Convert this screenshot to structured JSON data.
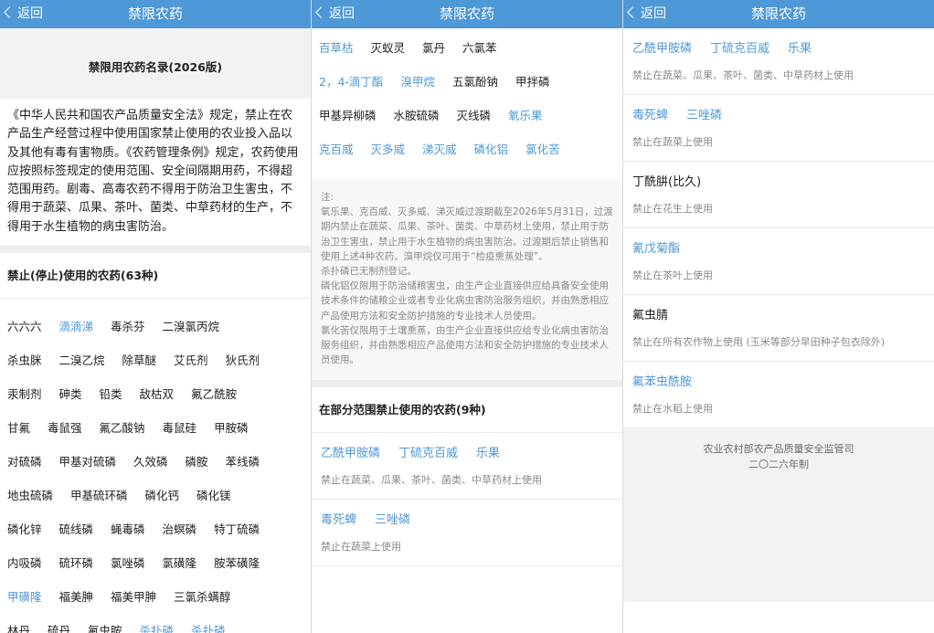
{
  "nav": {
    "back_label": "返回",
    "title": "禁限农药"
  },
  "panel1": {
    "list_title": "禁限用农药名录(2026版)",
    "intro_paragraph": "《中华人民共和国农产品质量安全法》规定，禁止在农产品生产经营过程中使用国家禁止使用的农业投入品以及其他有毒有害物质。《农药管理条例》规定，农药使用应按照标签规定的使用范围、安全间隔期用药，不得超范围用药。剧毒、高毒农药不得用于防治卫生害虫，不得用于蔬菜、瓜果、茶叶、菌类、中草药材的生产，不得用于水生植物的病虫害防治。",
    "banned_section_title": "禁止(停止)使用的农药(63种)",
    "banned_rows": [
      [
        {
          "name": "六六六",
          "blue": false
        },
        {
          "name": "滴滴涕",
          "blue": true
        },
        {
          "name": "毒杀芬",
          "blue": false
        },
        {
          "name": "二溴氯丙烷",
          "blue": false
        }
      ],
      [
        {
          "name": "杀虫脒",
          "blue": false
        },
        {
          "name": "二溴乙烷",
          "blue": false
        },
        {
          "name": "除草醚",
          "blue": false
        },
        {
          "name": "艾氏剂",
          "blue": false
        },
        {
          "name": "狄氏剂",
          "blue": false
        }
      ],
      [
        {
          "name": "汞制剂",
          "blue": false
        },
        {
          "name": "砷类",
          "blue": false
        },
        {
          "name": "铅类",
          "blue": false
        },
        {
          "name": "敌枯双",
          "blue": false
        },
        {
          "name": "氟乙酰胺",
          "blue": false
        }
      ],
      [
        {
          "name": "甘氟",
          "blue": false
        },
        {
          "name": "毒鼠强",
          "blue": false
        },
        {
          "name": "氟乙酸钠",
          "blue": false
        },
        {
          "name": "毒鼠硅",
          "blue": false
        },
        {
          "name": "甲胺磷",
          "blue": false
        }
      ],
      [
        {
          "name": "对硫磷",
          "blue": false
        },
        {
          "name": "甲基对硫磷",
          "blue": false
        },
        {
          "name": "久效磷",
          "blue": false
        },
        {
          "name": "磷胺",
          "blue": false
        },
        {
          "name": "苯线磷",
          "blue": false
        }
      ],
      [
        {
          "name": "地虫硫磷",
          "blue": false
        },
        {
          "name": "甲基硫环磷",
          "blue": false
        },
        {
          "name": "磷化钙",
          "blue": false
        },
        {
          "name": "磷化镁",
          "blue": false
        }
      ],
      [
        {
          "name": "磷化锌",
          "blue": false
        },
        {
          "name": "硫线磷",
          "blue": false
        },
        {
          "name": "蝇毒磷",
          "blue": false
        },
        {
          "name": "治螟磷",
          "blue": false
        },
        {
          "name": "特丁硫磷",
          "blue": false
        }
      ],
      [
        {
          "name": "内吸磷",
          "blue": false
        },
        {
          "name": "硫环磷",
          "blue": false
        },
        {
          "name": "氯唑磷",
          "blue": false
        },
        {
          "name": "氯磺隆",
          "blue": false
        },
        {
          "name": "胺苯磺隆",
          "blue": false
        }
      ],
      [
        {
          "name": "甲磺隆",
          "blue": true
        },
        {
          "name": "福美胂",
          "blue": false
        },
        {
          "name": "福美甲胂",
          "blue": false
        },
        {
          "name": "三氯杀螨醇",
          "blue": false
        }
      ],
      [
        {
          "name": "林丹",
          "blue": false
        },
        {
          "name": "硫丹",
          "blue": false
        },
        {
          "name": "氟虫胺",
          "blue": false
        },
        {
          "name": "杀扑磷",
          "blue": true
        },
        {
          "name": "杀扑磷",
          "blue": true
        }
      ]
    ]
  },
  "panel2": {
    "banned_rows": [
      [
        {
          "name": "百草枯",
          "blue": true
        },
        {
          "name": "灭蚁灵",
          "blue": false
        },
        {
          "name": "氯丹",
          "blue": false
        },
        {
          "name": "六氯苯",
          "blue": false
        }
      ],
      [
        {
          "name": "2，4-滴丁酯",
          "blue": true
        },
        {
          "name": "溴甲烷",
          "blue": true
        },
        {
          "name": "五氯酚钠",
          "blue": false
        },
        {
          "name": "甲拌磷",
          "blue": false
        }
      ],
      [
        {
          "name": "甲基异柳磷",
          "blue": false
        },
        {
          "name": "水胺硫磷",
          "blue": false
        },
        {
          "name": "灭线磷",
          "blue": false
        },
        {
          "name": "氧乐果",
          "blue": true
        }
      ],
      [
        {
          "name": "克百威",
          "blue": true
        },
        {
          "name": "灭多威",
          "blue": true
        },
        {
          "name": "涕灭威",
          "blue": true
        },
        {
          "name": "磷化铝",
          "blue": true
        },
        {
          "name": "氯化苦",
          "blue": true
        }
      ]
    ],
    "notes": [
      "注:",
      "氧乐果、克百威、灭多威、涕灭威过渡期截至2026年5月31日，过渡期内禁止在蔬菜、瓜果、茶叶、菌类、中草药材上使用，禁止用于防治卫生害虫，禁止用于水生植物的病虫害防治。过渡期后禁止销售和使用上述4种农药。溴甲烷仅可用于“检疫熏蒸处理”。",
      "杀扑磷已无制剂登记。",
      "磷化铝仅限用于防治储粮害虫，由生产企业直接供应给具备安全使用技术条件的储粮企业或者专业化病虫害防治服务组织，并由熟悉相应产品使用方法和安全防护措施的专业技术人员使用。",
      "氯化苦仅限用于土壤熏蒸，由生产企业直接供应给专业化病虫害防治服务组织，并由熟悉相应产品使用方法和安全防护措施的专业技术人员使用。"
    ],
    "restricted_section_title": "在部分范围禁止使用的农药(9种)",
    "restricted": [
      {
        "names": [
          {
            "name": "乙酰甲胺磷",
            "blue": true
          },
          {
            "name": "丁硫克百威",
            "blue": true
          },
          {
            "name": "乐果",
            "blue": true
          }
        ],
        "desc": "禁止在蔬菜、瓜果、茶叶、菌类、中草药材上使用"
      },
      {
        "names": [
          {
            "name": "毒死蜱",
            "blue": true
          },
          {
            "name": "三唑磷",
            "blue": true
          }
        ],
        "desc": "禁止在蔬菜上使用"
      }
    ]
  },
  "panel3": {
    "restricted": [
      {
        "names": [
          {
            "name": "乙酰甲胺磷",
            "blue": true
          },
          {
            "name": "丁硫克百威",
            "blue": true
          },
          {
            "name": "乐果",
            "blue": true
          }
        ],
        "desc": "禁止在蔬菜、瓜果、茶叶、菌类、中草药材上使用"
      },
      {
        "names": [
          {
            "name": "毒死蜱",
            "blue": true
          },
          {
            "name": "三唑磷",
            "blue": true
          }
        ],
        "desc": "禁止在蔬菜上使用"
      },
      {
        "names": [
          {
            "name": "丁酰肼(比久)",
            "blue": false
          }
        ],
        "desc": "禁止在花生上使用"
      },
      {
        "names": [
          {
            "name": "氰戊菊酯",
            "blue": true
          }
        ],
        "desc": "禁止在茶叶上使用"
      },
      {
        "names": [
          {
            "name": "氟虫腈",
            "blue": false
          }
        ],
        "desc": "禁止在所有农作物上使用 (玉米等部分旱田种子包衣除外)"
      },
      {
        "names": [
          {
            "name": "氟苯虫酰胺",
            "blue": true
          }
        ],
        "desc": "禁止在水稻上使用"
      }
    ],
    "footer_org": "农业农村部农产品质量安全监管司",
    "footer_year": "二〇二六年制"
  },
  "colors": {
    "nav_bar": "#4e98d7",
    "link_blue": "#4e98d7",
    "text": "#222222",
    "muted": "#8a8a8a"
  }
}
